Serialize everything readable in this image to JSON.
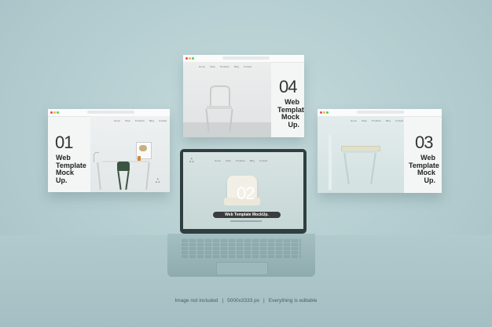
{
  "screens": [
    {
      "number": "01",
      "title": [
        "Web",
        "Template",
        "Mock",
        "Up."
      ],
      "nav": [
        "Home",
        "Shop",
        "Products",
        "Blog",
        "Contact"
      ]
    },
    {
      "number": "04",
      "title": [
        "Web",
        "Template",
        "Mock",
        "Up."
      ],
      "nav": [
        "Home",
        "Shop",
        "Products",
        "Blog",
        "Contact"
      ]
    },
    {
      "number": "03",
      "title": [
        "Web",
        "Template",
        "Mock",
        "Up."
      ],
      "nav": [
        "Home",
        "Shop",
        "Products",
        "Blog",
        "Contact"
      ]
    },
    {
      "number": "02",
      "banner": "Web Template MockUp.",
      "nav": [
        "Home",
        "Shop",
        "Products",
        "Blog",
        "Contact"
      ]
    }
  ],
  "caption": [
    "Image not included",
    "5000x3333 px",
    "Everything is editable"
  ],
  "colors": {
    "background": "#b4cdd0",
    "laptop": "#8eabae",
    "accent_dark": "#3c3c3c"
  }
}
